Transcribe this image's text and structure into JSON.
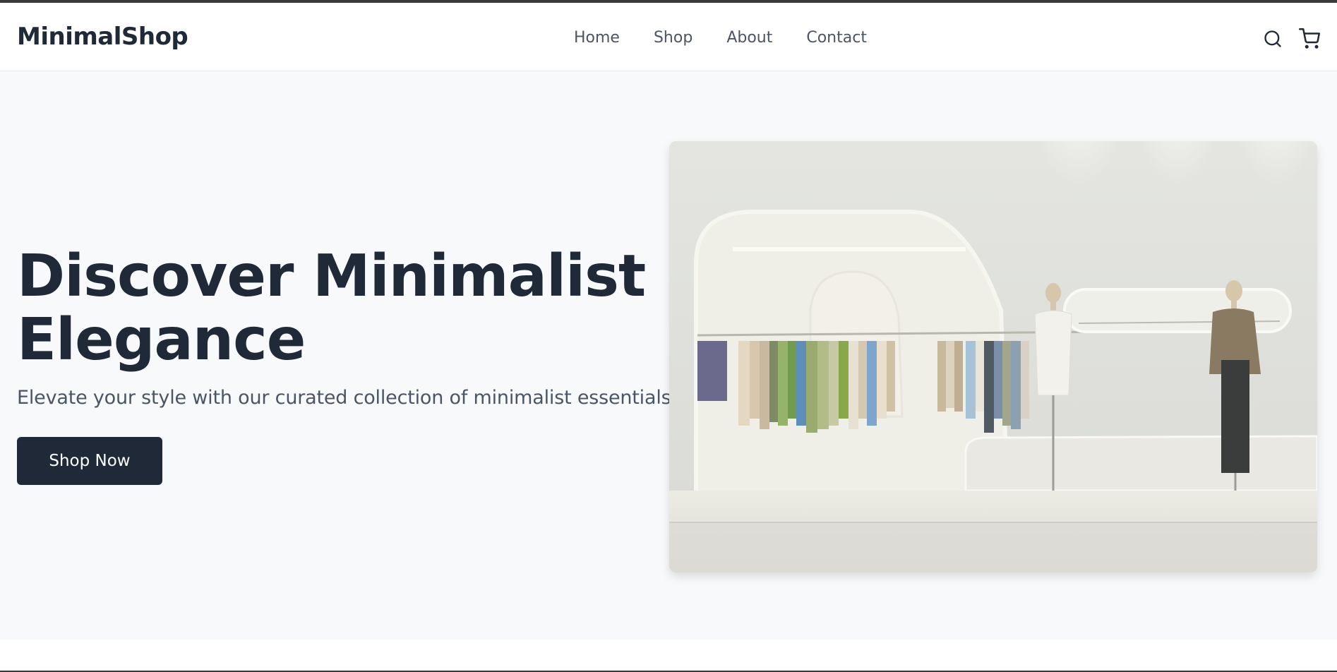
{
  "brand": {
    "name": "MinimalShop"
  },
  "nav": {
    "items": [
      {
        "label": "Home"
      },
      {
        "label": "Shop"
      },
      {
        "label": "About"
      },
      {
        "label": "Contact"
      }
    ]
  },
  "header_icons": [
    "search-icon",
    "cart-icon"
  ],
  "hero": {
    "title": "Discover Minimalist Elegance",
    "subtitle": "Elevate your style with our curated collection of minimalist essentials.",
    "cta_label": "Shop Now",
    "image": "minimalist-clothing-store-interior-photo"
  },
  "colors": {
    "primary": "#1f2937",
    "text_muted": "#4b5563",
    "hero_bg": "#f8f9fb",
    "header_bg": "#ffffff"
  }
}
